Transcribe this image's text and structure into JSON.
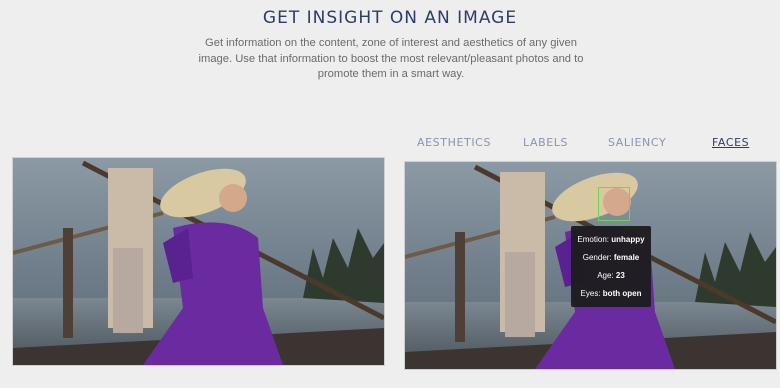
{
  "header": {
    "title": "GET INSIGHT ON AN IMAGE",
    "description": "Get information on the content, zone of interest and aesthetics of any given image. Use that information to boost the most relevant/pleasant photos and to promote them in a smart way."
  },
  "tabs": [
    {
      "label": "AESTHETICS"
    },
    {
      "label": "LABELS"
    },
    {
      "label": "SALIENCY"
    },
    {
      "label": "FACES"
    }
  ],
  "active_tab": "FACES",
  "face_info": {
    "emotion_label": "Emotion:",
    "emotion_value": "unhappy",
    "gender_label": "Gender:",
    "gender_value": "female",
    "age_label": "Age:",
    "age_value": "23",
    "eyes_label": "Eyes:",
    "eyes_value": "both open"
  },
  "colors": {
    "title": "#2c3d6b",
    "tab_inactive": "#8b93b3",
    "tab_active": "#2c3d6b",
    "face_box": "#6fd35a",
    "dress": "#6a2aa0"
  }
}
